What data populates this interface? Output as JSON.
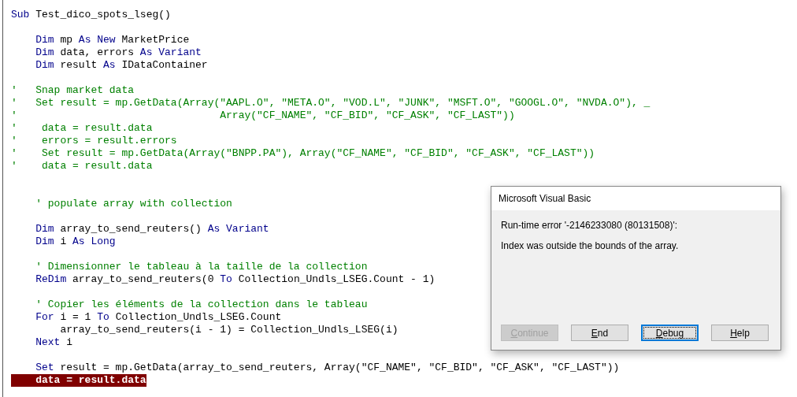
{
  "editor": {
    "lines": [
      {
        "kind": "code",
        "highlighted": false,
        "segments": [
          {
            "kind": "keyword",
            "text": "Sub"
          },
          {
            "kind": "text",
            "text": " Test_dico_spots_lseg()"
          }
        ]
      },
      {
        "kind": "blank"
      },
      {
        "kind": "code",
        "highlighted": false,
        "segments": [
          {
            "kind": "keyword",
            "text": "    Dim"
          },
          {
            "kind": "text",
            "text": " mp "
          },
          {
            "kind": "keyword",
            "text": "As New"
          },
          {
            "kind": "text",
            "text": " MarketPrice"
          }
        ]
      },
      {
        "kind": "code",
        "highlighted": false,
        "segments": [
          {
            "kind": "keyword",
            "text": "    Dim"
          },
          {
            "kind": "text",
            "text": " data, errors "
          },
          {
            "kind": "keyword",
            "text": "As Variant"
          }
        ]
      },
      {
        "kind": "code",
        "highlighted": false,
        "segments": [
          {
            "kind": "keyword",
            "text": "    Dim"
          },
          {
            "kind": "text",
            "text": " result "
          },
          {
            "kind": "keyword",
            "text": "As"
          },
          {
            "kind": "text",
            "text": " IDataContainer"
          }
        ]
      },
      {
        "kind": "blank"
      },
      {
        "kind": "comment",
        "highlighted": false,
        "text": "'   Snap market data"
      },
      {
        "kind": "comment",
        "highlighted": false,
        "text": "'   Set result = mp.GetData(Array(\"AAPL.O\", \"META.O\", \"VOD.L\", \"JUNK\", \"MSFT.O\", \"GOOGL.O\", \"NVDA.O\"), _"
      },
      {
        "kind": "comment",
        "highlighted": false,
        "text": "'                                 Array(\"CF_NAME\", \"CF_BID\", \"CF_ASK\", \"CF_LAST\"))"
      },
      {
        "kind": "comment",
        "highlighted": false,
        "text": "'    data = result.data"
      },
      {
        "kind": "comment",
        "highlighted": false,
        "text": "'    errors = result.errors"
      },
      {
        "kind": "comment",
        "highlighted": false,
        "text": "'    Set result = mp.GetData(Array(\"BNPP.PA\"), Array(\"CF_NAME\", \"CF_BID\", \"CF_ASK\", \"CF_LAST\"))"
      },
      {
        "kind": "comment",
        "highlighted": false,
        "text": "'    data = result.data"
      },
      {
        "kind": "blank"
      },
      {
        "kind": "blank"
      },
      {
        "kind": "comment",
        "highlighted": false,
        "text": "    ' populate array with collection"
      },
      {
        "kind": "blank"
      },
      {
        "kind": "code",
        "highlighted": false,
        "segments": [
          {
            "kind": "keyword",
            "text": "    Dim"
          },
          {
            "kind": "text",
            "text": " array_to_send_reuters() "
          },
          {
            "kind": "keyword",
            "text": "As Variant"
          }
        ]
      },
      {
        "kind": "code",
        "highlighted": false,
        "segments": [
          {
            "kind": "keyword",
            "text": "    Dim"
          },
          {
            "kind": "text",
            "text": " i "
          },
          {
            "kind": "keyword",
            "text": "As Long"
          }
        ]
      },
      {
        "kind": "blank"
      },
      {
        "kind": "comment",
        "highlighted": false,
        "text": "    ' Dimensionner le tableau à la taille de la collection"
      },
      {
        "kind": "code",
        "highlighted": false,
        "segments": [
          {
            "kind": "keyword",
            "text": "    ReDim"
          },
          {
            "kind": "text",
            "text": " array_to_send_reuters(0 "
          },
          {
            "kind": "keyword",
            "text": "To"
          },
          {
            "kind": "text",
            "text": " Collection_Undls_LSEG.Count - 1)"
          }
        ]
      },
      {
        "kind": "blank"
      },
      {
        "kind": "comment",
        "highlighted": false,
        "text": "    ' Copier les éléments de la collection dans le tableau"
      },
      {
        "kind": "code",
        "highlighted": false,
        "segments": [
          {
            "kind": "keyword",
            "text": "    For"
          },
          {
            "kind": "text",
            "text": " i = 1 "
          },
          {
            "kind": "keyword",
            "text": "To"
          },
          {
            "kind": "text",
            "text": " Collection_Undls_LSEG.Count"
          }
        ]
      },
      {
        "kind": "code",
        "highlighted": false,
        "segments": [
          {
            "kind": "text",
            "text": "        array_to_send_reuters(i - 1) = Collection_Undls_LSEG(i)"
          }
        ]
      },
      {
        "kind": "code",
        "highlighted": false,
        "segments": [
          {
            "kind": "keyword",
            "text": "    Next"
          },
          {
            "kind": "text",
            "text": " i"
          }
        ]
      },
      {
        "kind": "blank"
      },
      {
        "kind": "code",
        "highlighted": false,
        "segments": [
          {
            "kind": "keyword",
            "text": "    Set"
          },
          {
            "kind": "text",
            "text": " result = mp.GetData(array_to_send_reuters, Array(\"CF_NAME\", \"CF_BID\", \"CF_ASK\", \"CF_LAST\"))"
          }
        ]
      },
      {
        "kind": "code",
        "highlighted": true,
        "segments": [
          {
            "kind": "text",
            "text": "    data = result.data"
          }
        ]
      }
    ]
  },
  "dialog": {
    "title": "Microsoft Visual Basic",
    "error": "Run-time error '-2146233080 (80131508)':",
    "message": "Index was outside the bounds of the array.",
    "buttons": [
      {
        "label": "Continue",
        "disabled": true,
        "focused": false
      },
      {
        "label": "End",
        "disabled": false,
        "focused": false
      },
      {
        "label": "Debug",
        "disabled": false,
        "focused": true
      },
      {
        "label": "Help",
        "disabled": false,
        "focused": false
      }
    ]
  }
}
